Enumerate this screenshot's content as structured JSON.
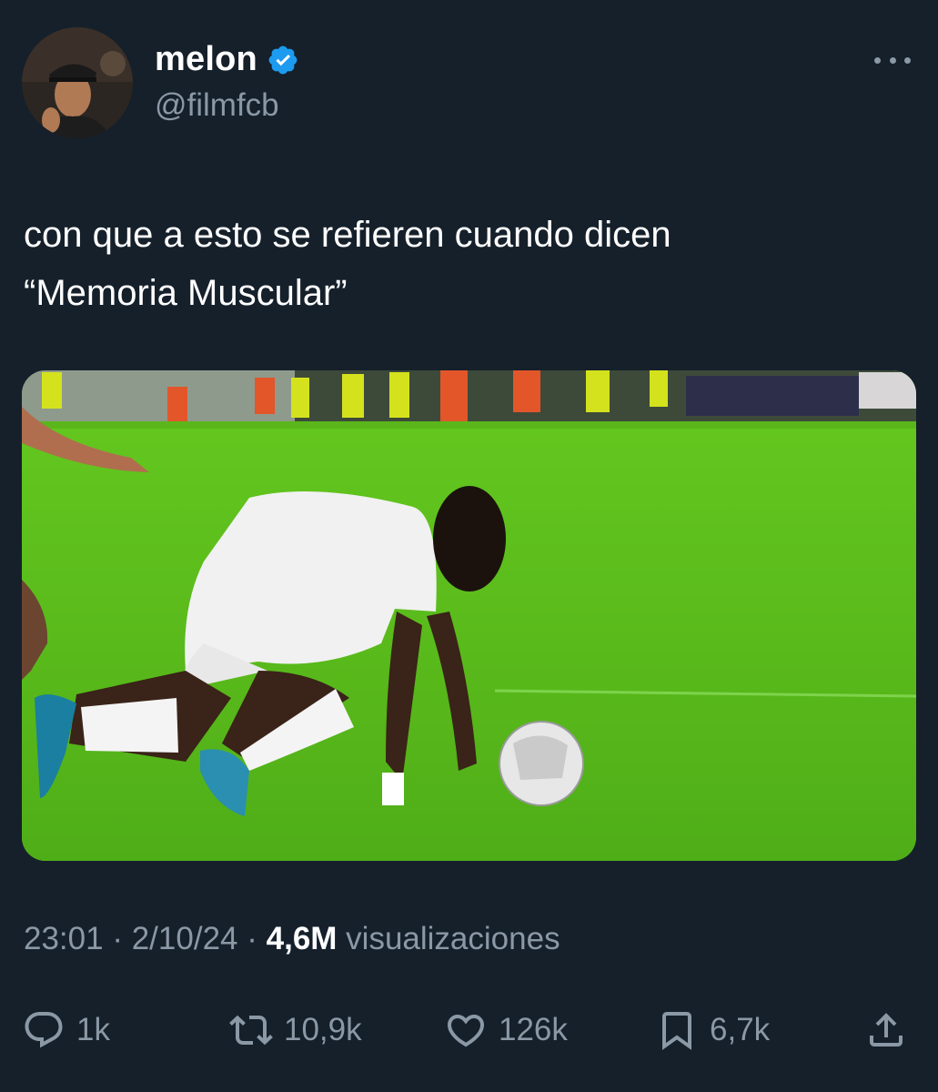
{
  "author": {
    "display_name": "melon",
    "handle": "@filmfcb",
    "verified": true
  },
  "tweet": {
    "text_lines": [
      "con que a esto se refieren cuando dicen",
      "“Memoria Muscular”"
    ]
  },
  "meta": {
    "time": "23:01",
    "separator": "·",
    "date": "2/10/24",
    "views_count": "4,6M",
    "views_label": "visualizaciones"
  },
  "actions": {
    "replies": "1k",
    "retweets": "10,9k",
    "likes": "126k",
    "bookmarks": "6,7k"
  },
  "icons": {
    "verified": "verified-badge-icon",
    "more": "more-icon",
    "reply": "reply-icon",
    "retweet": "retweet-icon",
    "like": "heart-icon",
    "bookmark": "bookmark-icon",
    "share": "share-icon"
  },
  "colors": {
    "background": "#15202b",
    "primary_text": "#ffffff",
    "secondary_text": "#8b98a5",
    "verified_blue": "#1d9bf0",
    "pitch_green": "#5fc21c"
  }
}
